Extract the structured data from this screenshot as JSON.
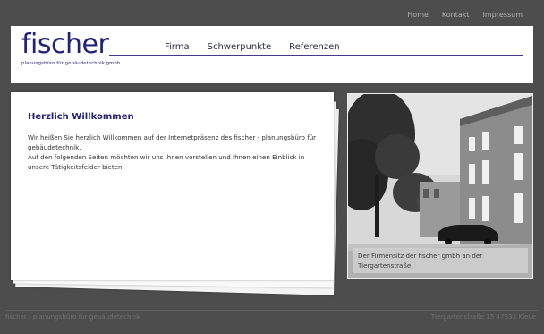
{
  "topnav": {
    "items": [
      "Home",
      "Kontakt",
      "Impressum"
    ]
  },
  "logo": {
    "word": "fischer",
    "sub": "planungsbüro für gebäudetechnik gmbh"
  },
  "mainnav": {
    "items": [
      "Firma",
      "Schwerpunkte",
      "Referenzen"
    ]
  },
  "welcome": {
    "title": "Herzlich Willkommen",
    "line1": "Wir heißen Sie herzlich Willkommen auf der Internetpräsenz des fischer - planungsbüro für gebäudetechnik.",
    "line2": "Auf den folgenden Seiten möchten wir uns Ihnen vorstellen und Ihnen einen Einblick in unsere Tätigkeitsfelder bieten."
  },
  "photo": {
    "caption": "Der Firmensitz der fischer gmbh an der Tiergartenstraße."
  },
  "footer": {
    "left": "fischer - planungsbüro für gebäudetechnik",
    "right": "Tiergartenstraße 15 47533 Kleve"
  },
  "colors": {
    "page_bg": "#4d4d4d",
    "brand": "#21237a",
    "nav_muted": "#b2b2b2",
    "footer_text": "#707070"
  }
}
